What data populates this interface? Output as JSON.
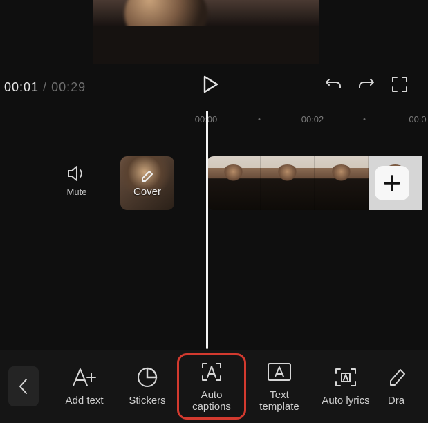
{
  "transport": {
    "current_time": "00:01",
    "separator": " / ",
    "duration": "00:29"
  },
  "ruler": {
    "ticks": [
      "00:00",
      "00:02",
      "00:0"
    ]
  },
  "track": {
    "mute_label": "Mute",
    "cover_label": "Cover"
  },
  "toolbar": {
    "add_text": "Add text",
    "stickers": "Stickers",
    "auto_captions_line1": "Auto",
    "auto_captions_line2": "captions",
    "text_template_line1": "Text",
    "text_template_line2": "template",
    "auto_lyrics": "Auto lyrics",
    "draw": "Dra"
  }
}
